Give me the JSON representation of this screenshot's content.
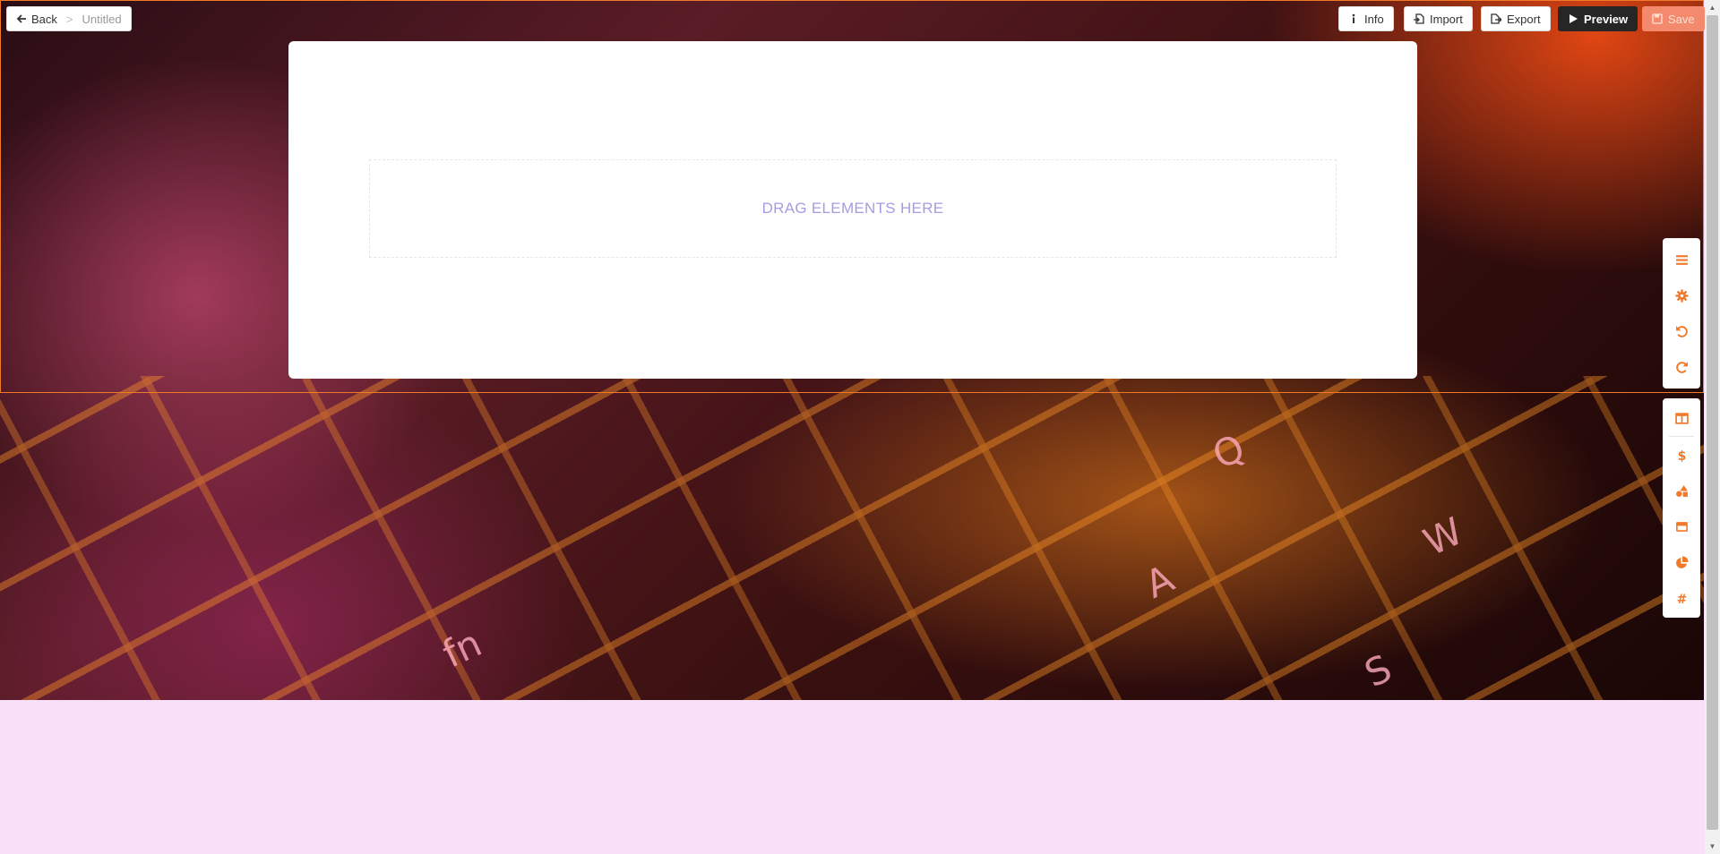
{
  "topbar": {
    "back_label": "Back",
    "breadcrumb_separator": ">",
    "doc_title": "Untitled",
    "info_label": "Info",
    "import_label": "Import",
    "export_label": "Export",
    "preview_label": "Preview",
    "save_label": "Save"
  },
  "canvas": {
    "dropzone_text": "DRAG ELEMENTS HERE",
    "keyboard_keys": [
      "fn",
      "A",
      "S",
      "W",
      "Q"
    ]
  },
  "side_toolbar_top": {
    "icons": [
      "menu-icon",
      "gear-icon",
      "undo-icon",
      "redo-icon"
    ]
  },
  "side_toolbar_bottom": {
    "icons": [
      "columns-icon",
      "dollar-icon",
      "shapes-icon",
      "card-icon",
      "pie-chart-icon",
      "hashtag-icon"
    ]
  },
  "colors": {
    "accent": "#f07a2a",
    "page_background": "#f8e1f8",
    "dropzone_text": "#a79be4",
    "preview_bg": "#262626",
    "save_bg": "#f48a6d"
  }
}
